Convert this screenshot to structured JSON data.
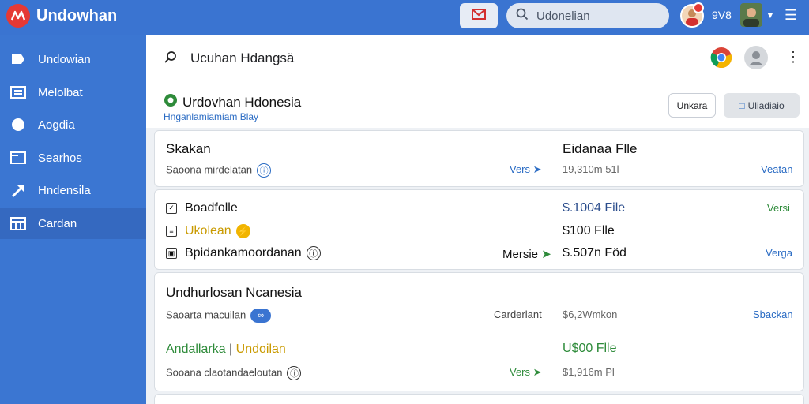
{
  "app": {
    "name": "Undowhan",
    "search_placeholder": "Udonelian",
    "top_count": "9V8",
    "notif_badge": "0"
  },
  "sidebar": {
    "items": [
      {
        "label": "Undowian",
        "icon": "home-icon"
      },
      {
        "label": "Melolbat",
        "icon": "grid-icon"
      },
      {
        "label": "Aogdia",
        "icon": "circle-icon"
      },
      {
        "label": "Searhos",
        "icon": "folder-icon"
      },
      {
        "label": "Hndensila",
        "icon": "trend-icon"
      },
      {
        "label": "Cardan",
        "icon": "calendar-icon"
      }
    ],
    "active_index": 5
  },
  "subbar": {
    "title": "Ucuhan Hdangsä"
  },
  "header": {
    "title": "Urdovhan Hdonesia",
    "subtitle": "Hnganlamiamiam Blay",
    "button_plain": "Unkara",
    "button_gray": "Uliadiaio"
  },
  "cards": {
    "c1": {
      "title": "Skakan",
      "subtitle": "Saoona mirdelatan",
      "mid_link": "Vers",
      "col_title": "Eidanaa Flle",
      "col_value": "19,310m 51l",
      "right_link": "Veatan"
    },
    "c2": {
      "rows": [
        {
          "label": "Boadfolle",
          "mid": "",
          "value": "$.1004 File",
          "right": "Versi"
        },
        {
          "label": "Ukolean",
          "mid": "",
          "value": "$100 Flle",
          "right": ""
        },
        {
          "label": "Bpidankamoordanan",
          "mid": "Mersie",
          "value": "$.507n Föd",
          "right": "Verga"
        }
      ]
    },
    "c3": {
      "title": "Undhurlosan Ncanesia",
      "sub1": "Saoarta macuilan",
      "mid1": "Carderlant",
      "value1": "$6,2Wmkon",
      "right1": "Sbackan",
      "line2_a": "Andallarka",
      "line2_b": "Undoilan",
      "value2": "U$00 Flle",
      "sub2": "Sooana claotandaeloutan",
      "mid2": "Vers",
      "value3": "$1,916m Pl"
    }
  }
}
